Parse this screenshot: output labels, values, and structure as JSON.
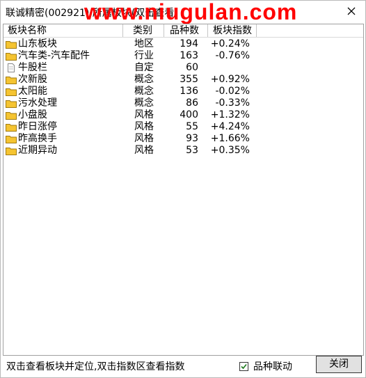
{
  "window": {
    "title": "联诚精密(002921) 所属板块(双击查看)",
    "watermark": "www.niugulan.com"
  },
  "table": {
    "columns": [
      "板块名称",
      "类别",
      "品种数",
      "板块指数"
    ],
    "rows": [
      {
        "name": "山东板块",
        "type": "地区",
        "count": "194",
        "index": "+0.24%",
        "icon": "folder-icon"
      },
      {
        "name": "汽车类-汽车配件",
        "type": "行业",
        "count": "163",
        "index": "-0.76%",
        "icon": "folder-icon"
      },
      {
        "name": "牛股栏",
        "type": "自定",
        "count": "60",
        "index": "",
        "icon": "document-icon"
      },
      {
        "name": "次新股",
        "type": "概念",
        "count": "355",
        "index": "+0.92%",
        "icon": "folder-icon"
      },
      {
        "name": "太阳能",
        "type": "概念",
        "count": "136",
        "index": "-0.02%",
        "icon": "folder-icon"
      },
      {
        "name": "污水处理",
        "type": "概念",
        "count": "86",
        "index": "-0.33%",
        "icon": "folder-icon"
      },
      {
        "name": "小盘股",
        "type": "风格",
        "count": "400",
        "index": "+1.32%",
        "icon": "folder-icon"
      },
      {
        "name": "昨日涨停",
        "type": "风格",
        "count": "55",
        "index": "+4.24%",
        "icon": "folder-icon"
      },
      {
        "name": "昨高换手",
        "type": "风格",
        "count": "93",
        "index": "+1.66%",
        "icon": "folder-icon"
      },
      {
        "name": "近期异动",
        "type": "风格",
        "count": "53",
        "index": "+0.35%",
        "icon": "folder-icon"
      }
    ]
  },
  "footer": {
    "status_text": "双击查看板块并定位,双击指数区查看指数",
    "checkbox_label": "品种联动",
    "checkbox_checked": true,
    "close_label": "关闭"
  },
  "colors": {
    "watermark": "#ff0000",
    "folder": "#f5c431",
    "check": "#1e7a1e"
  }
}
